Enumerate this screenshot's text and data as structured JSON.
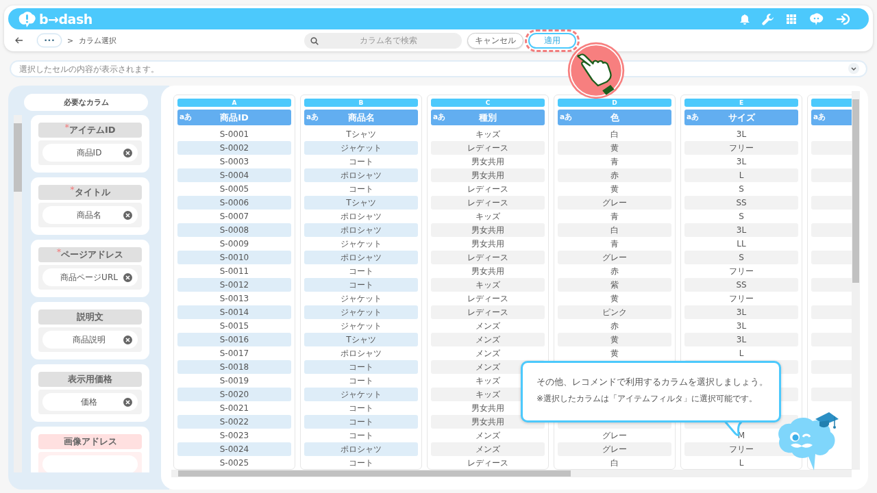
{
  "header": {
    "logo": "b→dash"
  },
  "toolbar": {
    "more": "•••",
    "separator": ">",
    "current": "カラム選択",
    "search": {
      "placeholder": "カラム名で検索"
    },
    "buttons": [
      {
        "label": "キャンセル",
        "kind": "cancel",
        "highlighted": false
      },
      {
        "label": "適用",
        "kind": "apply",
        "highlighted": true
      }
    ]
  },
  "cell_info": {
    "placeholder": "選択したセルの内容が表示されます。"
  },
  "required_panel": {
    "title": "必要なカラム",
    "fields": [
      {
        "label": "アイテムID",
        "mark": "*",
        "assigned": true,
        "value": "商品ID"
      },
      {
        "label": "タイトル",
        "mark": "*",
        "assigned": true,
        "value": "商品名"
      },
      {
        "label": "ページアドレス",
        "mark": "*",
        "assigned": true,
        "value": "商品ページURL"
      },
      {
        "label": "説明文",
        "assigned": true,
        "value": "商品説明"
      },
      {
        "label": "表示用価格",
        "assigned": true,
        "value": "価格"
      },
      {
        "label": "画像アドレス",
        "assigned": false
      }
    ]
  },
  "table": {
    "columns": [
      {
        "letter": "A",
        "type_badge": "aあ",
        "name": "商品ID",
        "selected": true
      },
      {
        "letter": "B",
        "type_badge": "aあ",
        "name": "商品名",
        "selected": true
      },
      {
        "letter": "C",
        "type_badge": "aあ",
        "name": "種別",
        "selected": false
      },
      {
        "letter": "D",
        "type_badge": "aあ",
        "name": "色",
        "selected": false
      },
      {
        "letter": "E",
        "type_badge": "aあ",
        "name": "サイズ",
        "selected": false
      },
      {
        "type_badge": "aあ",
        "selected": false
      }
    ],
    "rows": [
      [
        "S-0001",
        "Tシャツ",
        "キッズ",
        "白",
        "3L"
      ],
      [
        "S-0002",
        "ジャケット",
        "レディース",
        "黄",
        "フリー"
      ],
      [
        "S-0003",
        "コート",
        "男女共用",
        "青",
        "3L"
      ],
      [
        "S-0004",
        "ポロシャツ",
        "男女共用",
        "赤",
        "L"
      ],
      [
        "S-0005",
        "コート",
        "レディース",
        "黄",
        "S"
      ],
      [
        "S-0006",
        "Tシャツ",
        "レディース",
        "グレー",
        "SS"
      ],
      [
        "S-0007",
        "ポロシャツ",
        "キッズ",
        "青",
        "S"
      ],
      [
        "S-0008",
        "ポロシャツ",
        "男女共用",
        "白",
        "3L"
      ],
      [
        "S-0009",
        "ジャケット",
        "男女共用",
        "青",
        "LL"
      ],
      [
        "S-0010",
        "ポロシャツ",
        "レディース",
        "グレー",
        "S"
      ],
      [
        "S-0011",
        "コート",
        "男女共用",
        "赤",
        "フリー"
      ],
      [
        "S-0012",
        "コート",
        "キッズ",
        "紫",
        "SS"
      ],
      [
        "S-0013",
        "ジャケット",
        "レディース",
        "黄",
        "フリー"
      ],
      [
        "S-0014",
        "ジャケット",
        "レディース",
        "ピンク",
        "3L"
      ],
      [
        "S-0015",
        "ジャケット",
        "メンズ",
        "赤",
        "3L"
      ],
      [
        "S-0016",
        "Tシャツ",
        "メンズ",
        "黄",
        "3L"
      ],
      [
        "S-0017",
        "ポロシャツ",
        "メンズ",
        "黄",
        "L"
      ],
      [
        "S-0018",
        "コート",
        "メンズ",
        null,
        null
      ],
      [
        "S-0019",
        "コート",
        "キッズ",
        null,
        null
      ],
      [
        "S-0020",
        "ジャケット",
        "キッズ",
        null,
        null
      ],
      [
        "S-0021",
        "コート",
        "男女共用",
        null,
        null
      ],
      [
        "S-0022",
        "コート",
        "男女共用",
        null,
        null
      ],
      [
        "S-0023",
        "コート",
        "メンズ",
        "グレー",
        "M"
      ],
      [
        "S-0024",
        "ポロシャツ",
        "メンズ",
        "グレー",
        "フリー"
      ],
      [
        "S-0025",
        "コート",
        "レディース",
        "白",
        "L"
      ]
    ]
  },
  "tip": {
    "message": "その他、レコメンドで利用するカラムを選択しましょう。",
    "note": "※選択したカラムは「アイテムフィルタ」に選択可能です。"
  }
}
